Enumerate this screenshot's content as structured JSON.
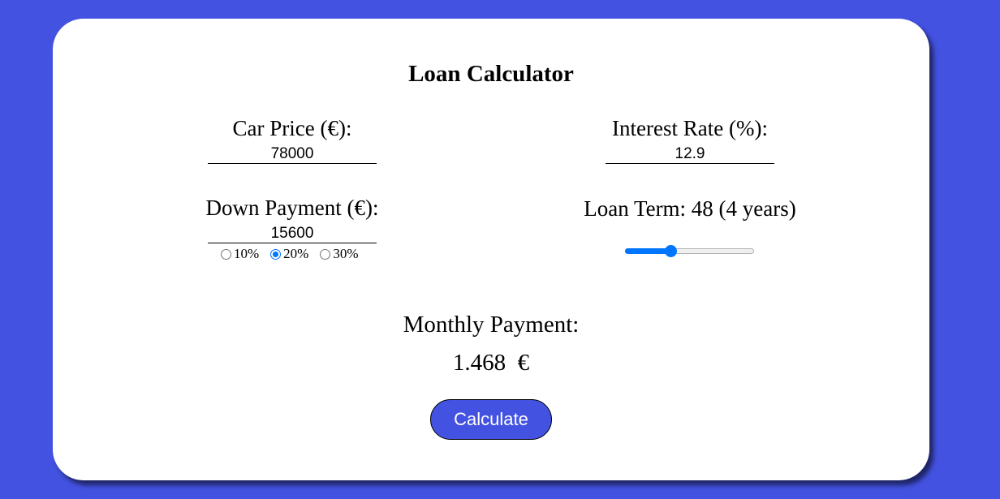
{
  "title": "Loan Calculator",
  "car_price": {
    "label": "Car Price (€):",
    "value": "78000"
  },
  "interest_rate": {
    "label": "Interest Rate (%):",
    "value": "12.9"
  },
  "down_payment": {
    "label": "Down Payment (€):",
    "value": "15600",
    "options": [
      {
        "label": "10%",
        "checked": false
      },
      {
        "label": "20%",
        "checked": true
      },
      {
        "label": "30%",
        "checked": false
      }
    ]
  },
  "loan_term": {
    "label": "Loan Term: 48 (4 years)",
    "slider_fraction": 0.35
  },
  "result": {
    "label": "Monthly Payment:",
    "value": "1.468  €"
  },
  "calculate_label": "Calculate",
  "colors": {
    "background": "#4352e0",
    "accent": "#0075ff",
    "button": "#4352e0"
  }
}
